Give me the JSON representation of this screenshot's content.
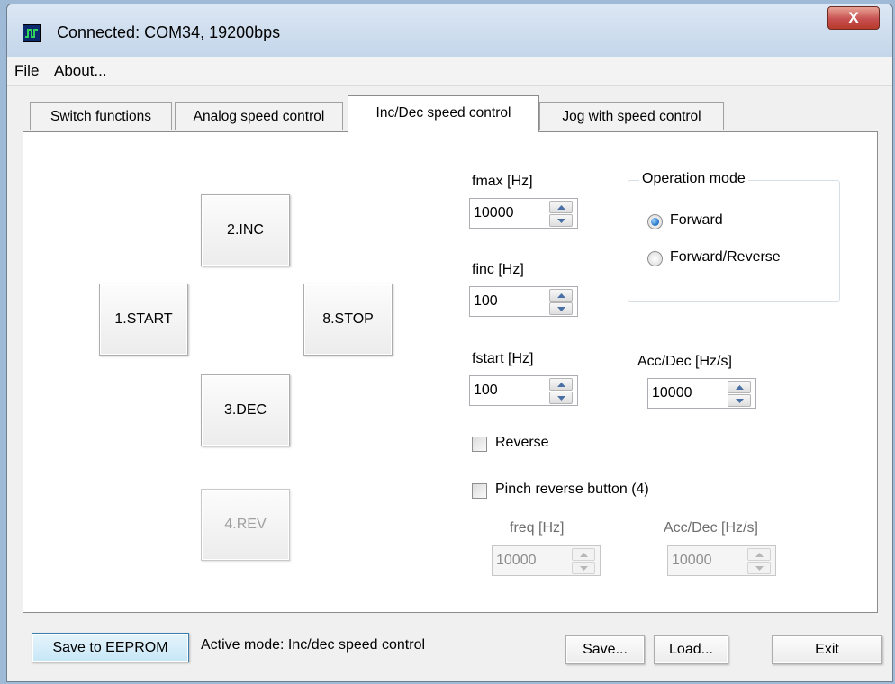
{
  "window": {
    "title": "Connected: COM34, 19200bps",
    "close_label": "X"
  },
  "menu": [
    "File",
    "About..."
  ],
  "tabs": [
    "Switch functions",
    "Analog speed control",
    "Inc/Dec speed control",
    "Jog with speed control"
  ],
  "active_tab": "Inc/Dec speed control",
  "pad": {
    "inc": "2.INC",
    "start": "1.START",
    "stop": "8.STOP",
    "dec": "3.DEC",
    "rev": "4.REV"
  },
  "fields": {
    "fmax": {
      "label": "fmax [Hz]",
      "value": "10000"
    },
    "finc": {
      "label": "finc [Hz]",
      "value": "100"
    },
    "fstart": {
      "label": "fstart [Hz]",
      "value": "100"
    },
    "accdec": {
      "label": "Acc/Dec [Hz/s]",
      "value": "10000"
    },
    "freq": {
      "label": "freq [Hz]",
      "value": "10000"
    },
    "pinch_accdec": {
      "label": "Acc/Dec [Hz/s]",
      "value": "10000"
    }
  },
  "operation_mode": {
    "title": "Operation mode",
    "options": [
      "Forward",
      "Forward/Reverse"
    ],
    "selected": "Forward"
  },
  "checkboxes": {
    "reverse": "Reverse",
    "pinch": "Pinch reverse button (4)"
  },
  "bottom": {
    "save_eeprom": "Save to EEPROM",
    "status": "Active mode: Inc/dec speed control",
    "save": "Save...",
    "load": "Load...",
    "exit": "Exit"
  },
  "colors": {
    "accent_button": "#d7eef8",
    "window_bg": "#f0f0f0",
    "titlebar": "#c4d6ea"
  }
}
